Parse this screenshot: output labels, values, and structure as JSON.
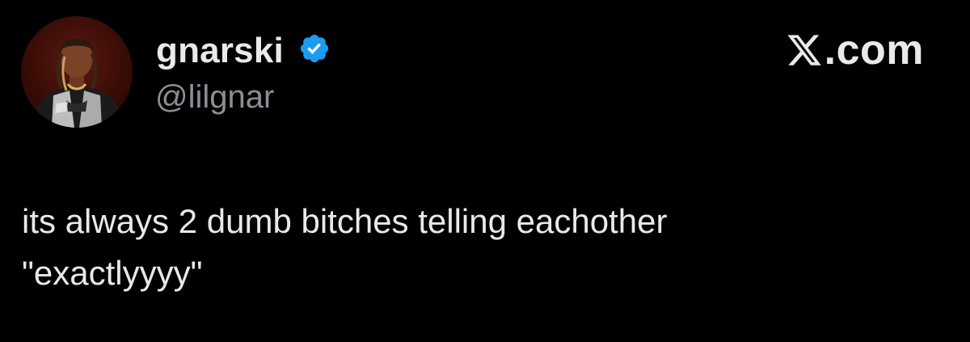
{
  "author": {
    "display_name": "gnarski",
    "handle": "@lilgnar",
    "verified": true,
    "avatar": "avatar-photo"
  },
  "brand": {
    "mark": "x-logo-icon",
    "domain_text": ".com"
  },
  "tweet": {
    "lines": [
      "its always 2 dumb bitches telling eachother",
      "\"exactlyyyy\""
    ]
  },
  "colors": {
    "background": "#000000",
    "text": "#e7e9ea",
    "secondary_text": "#8b8f94",
    "verified_blue": "#1d9bf0"
  }
}
